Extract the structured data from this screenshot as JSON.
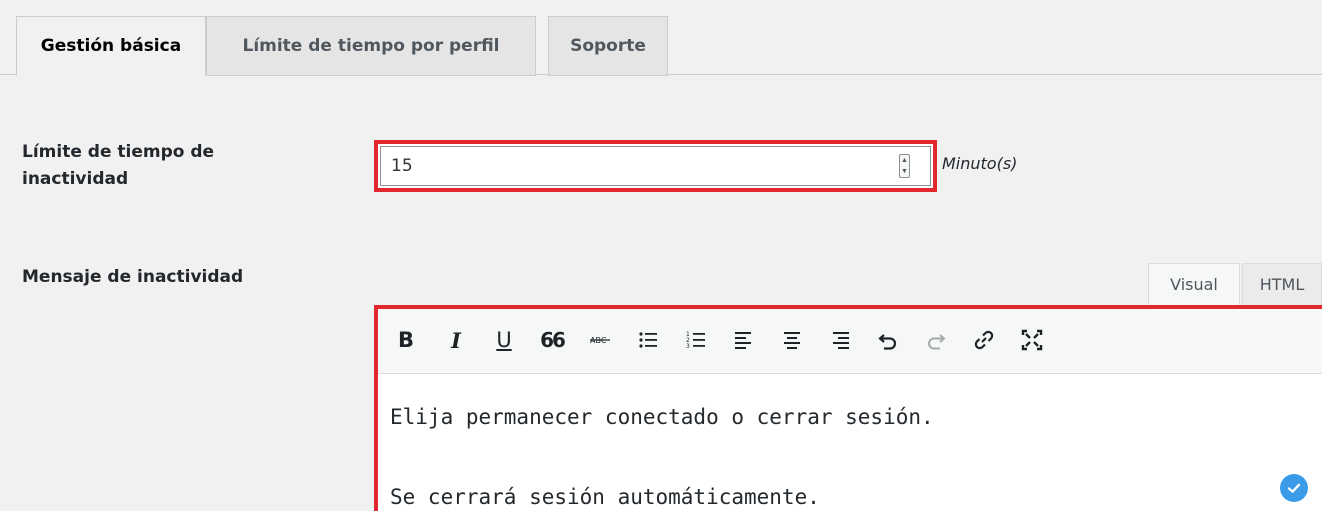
{
  "tabs": [
    {
      "label": "Gestión básica",
      "active": true
    },
    {
      "label": "Límite de tiempo por perfil",
      "active": false
    },
    {
      "label": "Soporte",
      "active": false
    }
  ],
  "idle_timeout": {
    "label_line1": "Límite de tiempo de",
    "label_line2": "inactividad",
    "value": "15",
    "unit": "Minuto(s)"
  },
  "idle_message": {
    "label": "Mensaje de inactividad",
    "mode_visual": "Visual",
    "mode_html": "HTML",
    "toolbar": {
      "bold": "B",
      "italic": "I",
      "underline": "U",
      "blockquote": "66"
    },
    "content": [
      "Elija permanecer conectado o cerrar sesión.",
      "Se cerrará sesión automáticamente."
    ]
  },
  "colors": {
    "highlight_border": "#e0282e",
    "check_badge": "#3b9be8"
  },
  "icons": [
    "bold-icon",
    "italic-icon",
    "underline-icon",
    "blockquote-icon",
    "strikethrough-icon",
    "bulleted-list-icon",
    "numbered-list-icon",
    "align-left-icon",
    "align-center-icon",
    "align-right-icon",
    "undo-icon",
    "redo-icon",
    "link-icon",
    "fullscreen-icon",
    "check-circle-icon"
  ]
}
